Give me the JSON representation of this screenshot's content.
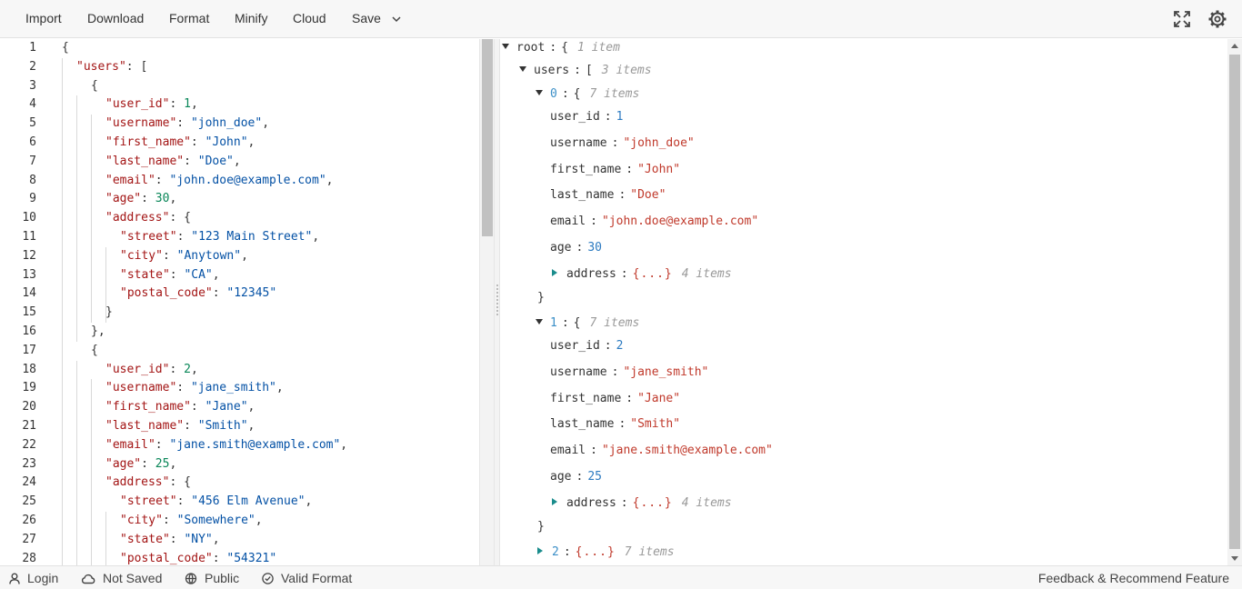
{
  "toolbar": {
    "import_label": "Import",
    "download_label": "Download",
    "format_label": "Format",
    "minify_label": "Minify",
    "cloud_label": "Cloud",
    "save_label": "Save",
    "icons": [
      "fullscreen-icon",
      "gear-icon"
    ]
  },
  "editor": {
    "line_numbers": [
      "1",
      "2",
      "3",
      "4",
      "5",
      "6",
      "7",
      "8",
      "9",
      "10",
      "11",
      "12",
      "13",
      "14",
      "15",
      "16",
      "17",
      "18",
      "19",
      "20",
      "21",
      "22",
      "23",
      "24",
      "25",
      "26",
      "27",
      "28"
    ],
    "lines": [
      [
        "{"
      ],
      [
        "\"users\"",
        ": ["
      ],
      [
        "{"
      ],
      [
        "\"user_id\"",
        ": ",
        "1",
        ","
      ],
      [
        "\"username\"",
        ": ",
        "\"john_doe\"",
        ","
      ],
      [
        "\"first_name\"",
        ": ",
        "\"John\"",
        ","
      ],
      [
        "\"last_name\"",
        ": ",
        "\"Doe\"",
        ","
      ],
      [
        "\"email\"",
        ": ",
        "\"john.doe@example.com\"",
        ","
      ],
      [
        "\"age\"",
        ": ",
        "30",
        ","
      ],
      [
        "\"address\"",
        ": {"
      ],
      [
        "\"street\"",
        ": ",
        "\"123 Main Street\"",
        ","
      ],
      [
        "\"city\"",
        ": ",
        "\"Anytown\"",
        ","
      ],
      [
        "\"state\"",
        ": ",
        "\"CA\"",
        ","
      ],
      [
        "\"postal_code\"",
        ": ",
        "\"12345\""
      ],
      [
        "}"
      ],
      [
        "},"
      ],
      [
        "{"
      ],
      [
        "\"user_id\"",
        ": ",
        "2",
        ","
      ],
      [
        "\"username\"",
        ": ",
        "\"jane_smith\"",
        ","
      ],
      [
        "\"first_name\"",
        ": ",
        "\"Jane\"",
        ","
      ],
      [
        "\"last_name\"",
        ": ",
        "\"Smith\"",
        ","
      ],
      [
        "\"email\"",
        ": ",
        "\"jane.smith@example.com\"",
        ","
      ],
      [
        "\"age\"",
        ": ",
        "25",
        ","
      ],
      [
        "\"address\"",
        ": {"
      ],
      [
        "\"street\"",
        ": ",
        "\"456 Elm Avenue\"",
        ","
      ],
      [
        "\"city\"",
        ": ",
        "\"Somewhere\"",
        ","
      ],
      [
        "\"state\"",
        ": ",
        "\"NY\"",
        ","
      ],
      [
        "\"postal_code\"",
        ": ",
        "\"54321\""
      ]
    ]
  },
  "tree": {
    "root": {
      "key": "root",
      "open": "{",
      "count": "1 item"
    },
    "users": {
      "key": "users",
      "open": "[",
      "count": "3 items"
    },
    "items": [
      {
        "index": "0",
        "open": "{",
        "count": "7 items",
        "fields": [
          {
            "key": "user_id",
            "value": "1",
            "kind": "num"
          },
          {
            "key": "username",
            "value": "\"john_doe\"",
            "kind": "str"
          },
          {
            "key": "first_name",
            "value": "\"John\"",
            "kind": "str"
          },
          {
            "key": "last_name",
            "value": "\"Doe\"",
            "kind": "str"
          },
          {
            "key": "email",
            "value": "\"john.doe@example.com\"",
            "kind": "str"
          },
          {
            "key": "age",
            "value": "30",
            "kind": "num"
          }
        ],
        "address": {
          "key": "address",
          "collapsed": "{...}",
          "count": "4 items"
        },
        "close": "}"
      },
      {
        "index": "1",
        "open": "{",
        "count": "7 items",
        "fields": [
          {
            "key": "user_id",
            "value": "2",
            "kind": "num"
          },
          {
            "key": "username",
            "value": "\"jane_smith\"",
            "kind": "str"
          },
          {
            "key": "first_name",
            "value": "\"Jane\"",
            "kind": "str"
          },
          {
            "key": "last_name",
            "value": "\"Smith\"",
            "kind": "str"
          },
          {
            "key": "email",
            "value": "\"jane.smith@example.com\"",
            "kind": "str"
          },
          {
            "key": "age",
            "value": "25",
            "kind": "num"
          }
        ],
        "address": {
          "key": "address",
          "collapsed": "{...}",
          "count": "4 items"
        },
        "close": "}"
      }
    ],
    "collapsed_item": {
      "index": "2",
      "collapsed": "{...}",
      "count": "7 items"
    },
    "separator": ":"
  },
  "status": {
    "login_label": "Login",
    "saved_label": "Not Saved",
    "visibility_label": "Public",
    "validity_label": "Valid Format",
    "feedback_label": "Feedback & Recommend Feature"
  },
  "colors": {
    "key": "#a31515",
    "string": "#0451a5",
    "number": "#098658",
    "tree_string": "#c0392b",
    "tree_number": "#2d7bc1",
    "tree_index": "#3b8fc7"
  }
}
